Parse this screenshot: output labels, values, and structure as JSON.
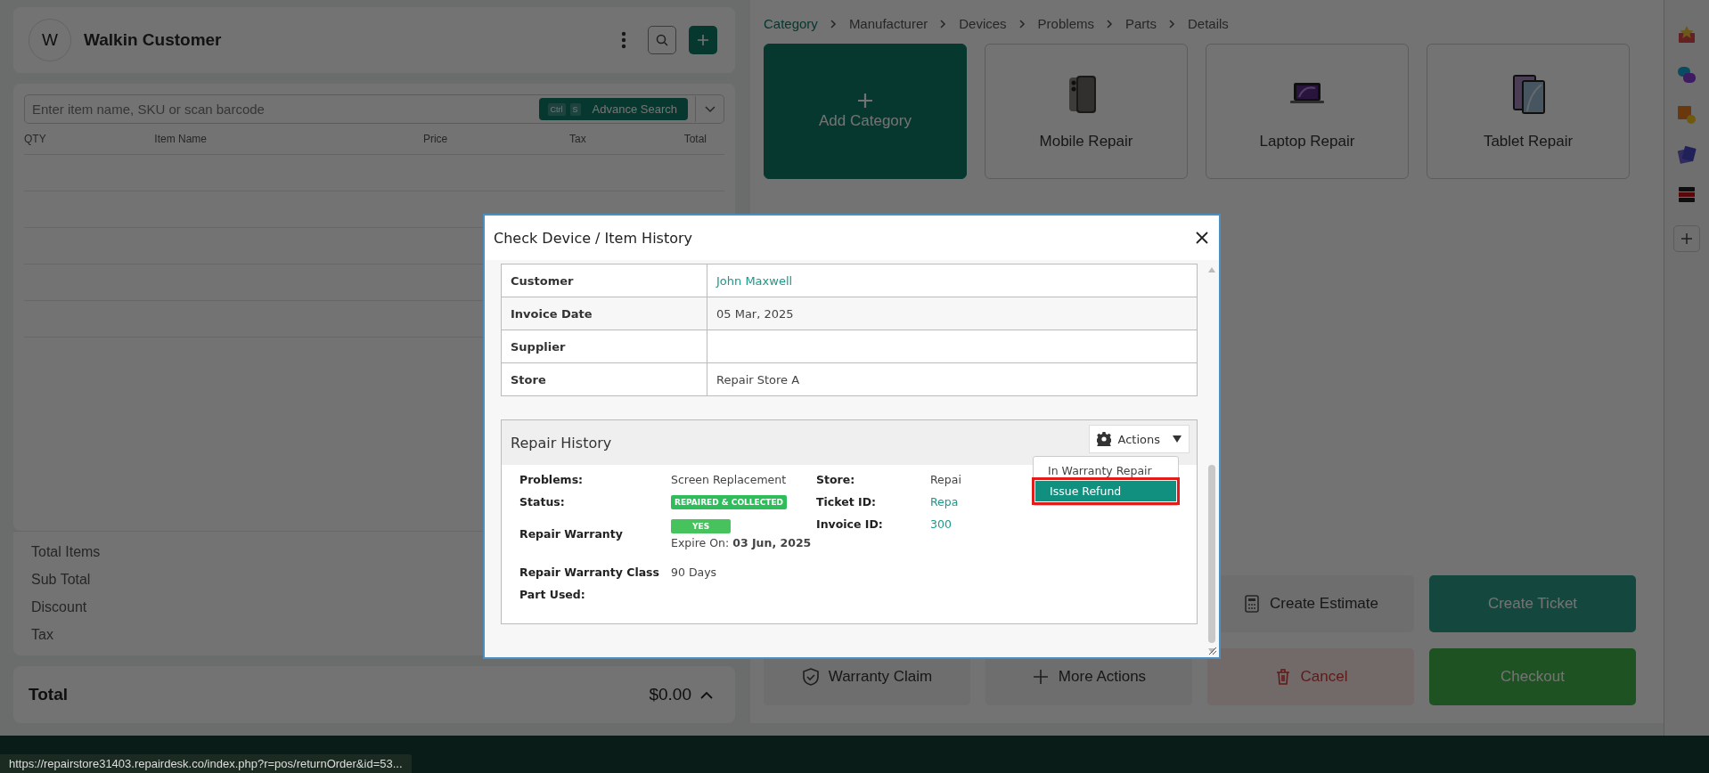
{
  "customer_header": {
    "avatar": "W",
    "name": "Walkin Customer"
  },
  "item_search": {
    "placeholder": "Enter item name, SKU or scan barcode",
    "shortcut_keys": [
      "Ctrl",
      "S"
    ],
    "button": "Advance Search"
  },
  "cart_table": {
    "columns": [
      "QTY",
      "Item Name",
      "Price",
      "Tax",
      "Total"
    ]
  },
  "summary": {
    "rows": [
      "Total Items",
      "Sub Total",
      "Discount",
      "Tax"
    ]
  },
  "total": {
    "label": "Total",
    "amount": "$0.00"
  },
  "breadcrumb": [
    {
      "label": "Category",
      "selected": true
    },
    {
      "label": "Manufacturer",
      "selected": false
    },
    {
      "label": "Devices",
      "selected": false
    },
    {
      "label": "Problems",
      "selected": false
    },
    {
      "label": "Parts",
      "selected": false
    },
    {
      "label": "Details",
      "selected": false
    }
  ],
  "categories": [
    {
      "kind": "add",
      "label": "Add Category"
    },
    {
      "kind": "phone",
      "label": "Mobile Repair"
    },
    {
      "kind": "laptop",
      "label": "Laptop Repair"
    },
    {
      "kind": "tablet",
      "label": "Tablet Repair"
    }
  ],
  "action_rows": [
    [
      {
        "kind": "estimate",
        "label": "Create Estimate"
      },
      {
        "kind": "ticket",
        "label": "Create Ticket"
      }
    ],
    [
      {
        "kind": "warranty",
        "label": "Warranty Claim"
      },
      {
        "kind": "more",
        "label": "More Actions"
      },
      {
        "kind": "cancel",
        "label": "Cancel"
      },
      {
        "kind": "checkout",
        "label": "Checkout"
      }
    ]
  ],
  "modal": {
    "title": "Check Device / Item History",
    "details": [
      {
        "label": "Customer",
        "value": "John Maxwell",
        "kind": "link"
      },
      {
        "label": "Invoice Date",
        "value": "05 Mar, 2025",
        "kind": "text"
      },
      {
        "label": "Supplier",
        "kind": "text"
      },
      {
        "label": "Store",
        "value": "Repair Store A",
        "kind": "text"
      }
    ],
    "repair_history": {
      "title": "Repair History",
      "actions_button": "Actions",
      "fields_left": [
        {
          "label": "Problems:",
          "kind": "text",
          "value": "Screen Replacement"
        },
        {
          "label": "Status:",
          "kind": "badge",
          "value": "REPAIRED & COLLECTED"
        },
        {
          "label": "Repair Warranty",
          "kind": "warranty",
          "badge": "YES",
          "note": "Expire On: **03 Jun, 2025**"
        },
        {
          "label": "Repair Warranty Class",
          "kind": "text",
          "value": "90 Days"
        },
        {
          "label": "Part Used:",
          "kind": "text"
        }
      ],
      "fields_right": [
        {
          "label": "Store:",
          "kind": "text",
          "value": "Repai"
        },
        {
          "label": "Ticket ID:",
          "kind": "link",
          "value": "Repa"
        },
        {
          "label": "Invoice ID:",
          "kind": "link",
          "value": "300"
        }
      ]
    },
    "actions_menu": [
      {
        "label": "In Warranty Repair",
        "selected": false,
        "highlighted": false
      },
      {
        "label": "Issue Refund",
        "selected": true,
        "highlighted": true
      }
    ]
  },
  "status_url": "https://repairstore31403.repairdesk.co/index.php?r=pos/returnOrder&id=53..."
}
